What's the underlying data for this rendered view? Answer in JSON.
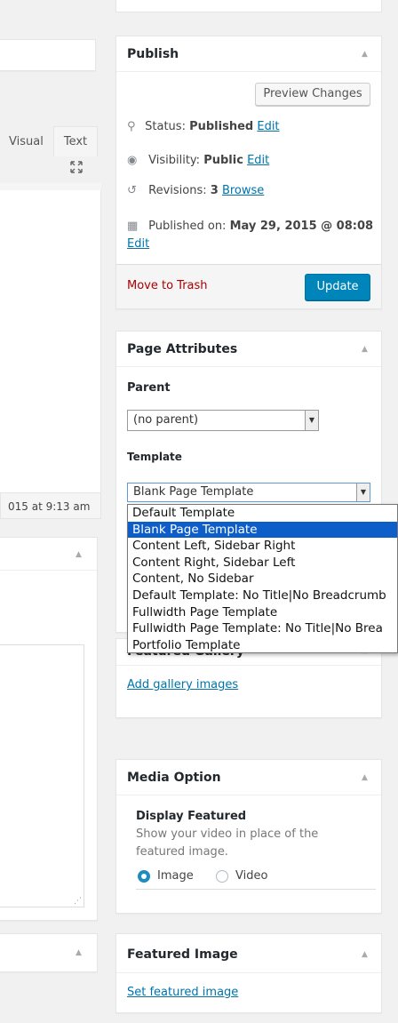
{
  "editor": {
    "tab_visual": "Visual",
    "tab_text": "Text",
    "last_edited": "015 at 9:13 am"
  },
  "publish": {
    "title": "Publish",
    "preview_button": "Preview Changes",
    "status_label": "Status:",
    "status_value": "Published",
    "status_edit": "Edit",
    "visibility_label": "Visibility:",
    "visibility_value": "Public",
    "visibility_edit": "Edit",
    "revisions_label": "Revisions:",
    "revisions_value": "3",
    "revisions_browse": "Browse",
    "published_label": "Published on:",
    "published_value": "May 29, 2015 @ 08:08",
    "published_edit": "Edit",
    "trash": "Move to Trash",
    "update_button": "Update"
  },
  "page_attributes": {
    "title": "Page Attributes",
    "parent_label": "Parent",
    "parent_value": "(no parent)",
    "template_label": "Template",
    "template_value": "Blank Page Template",
    "template_options": [
      "Default Template",
      "Blank Page Template",
      "Content Left, Sidebar Right",
      "Content Right, Sidebar Left",
      "Content, No Sidebar",
      "Default Template: No Title|No Breadcrumb",
      "Fullwidth Page Template",
      "Fullwidth Page Template: No Title|No Brea",
      "Portfolio Template"
    ]
  },
  "featured_gallery": {
    "title": "Featured Gallery",
    "add_link": "Add gallery images"
  },
  "media_option": {
    "title": "Media Option",
    "field_title": "Display Featured",
    "field_desc": "Show your video in place of the featured image.",
    "option_image": "Image",
    "option_video": "Video",
    "selected": "Image"
  },
  "featured_image": {
    "title": "Featured Image",
    "set_link": "Set featured image"
  },
  "colors": {
    "link": "#0073aa",
    "primary": "#0085ba",
    "trash": "#a00",
    "selection": "#0d5ec8"
  }
}
